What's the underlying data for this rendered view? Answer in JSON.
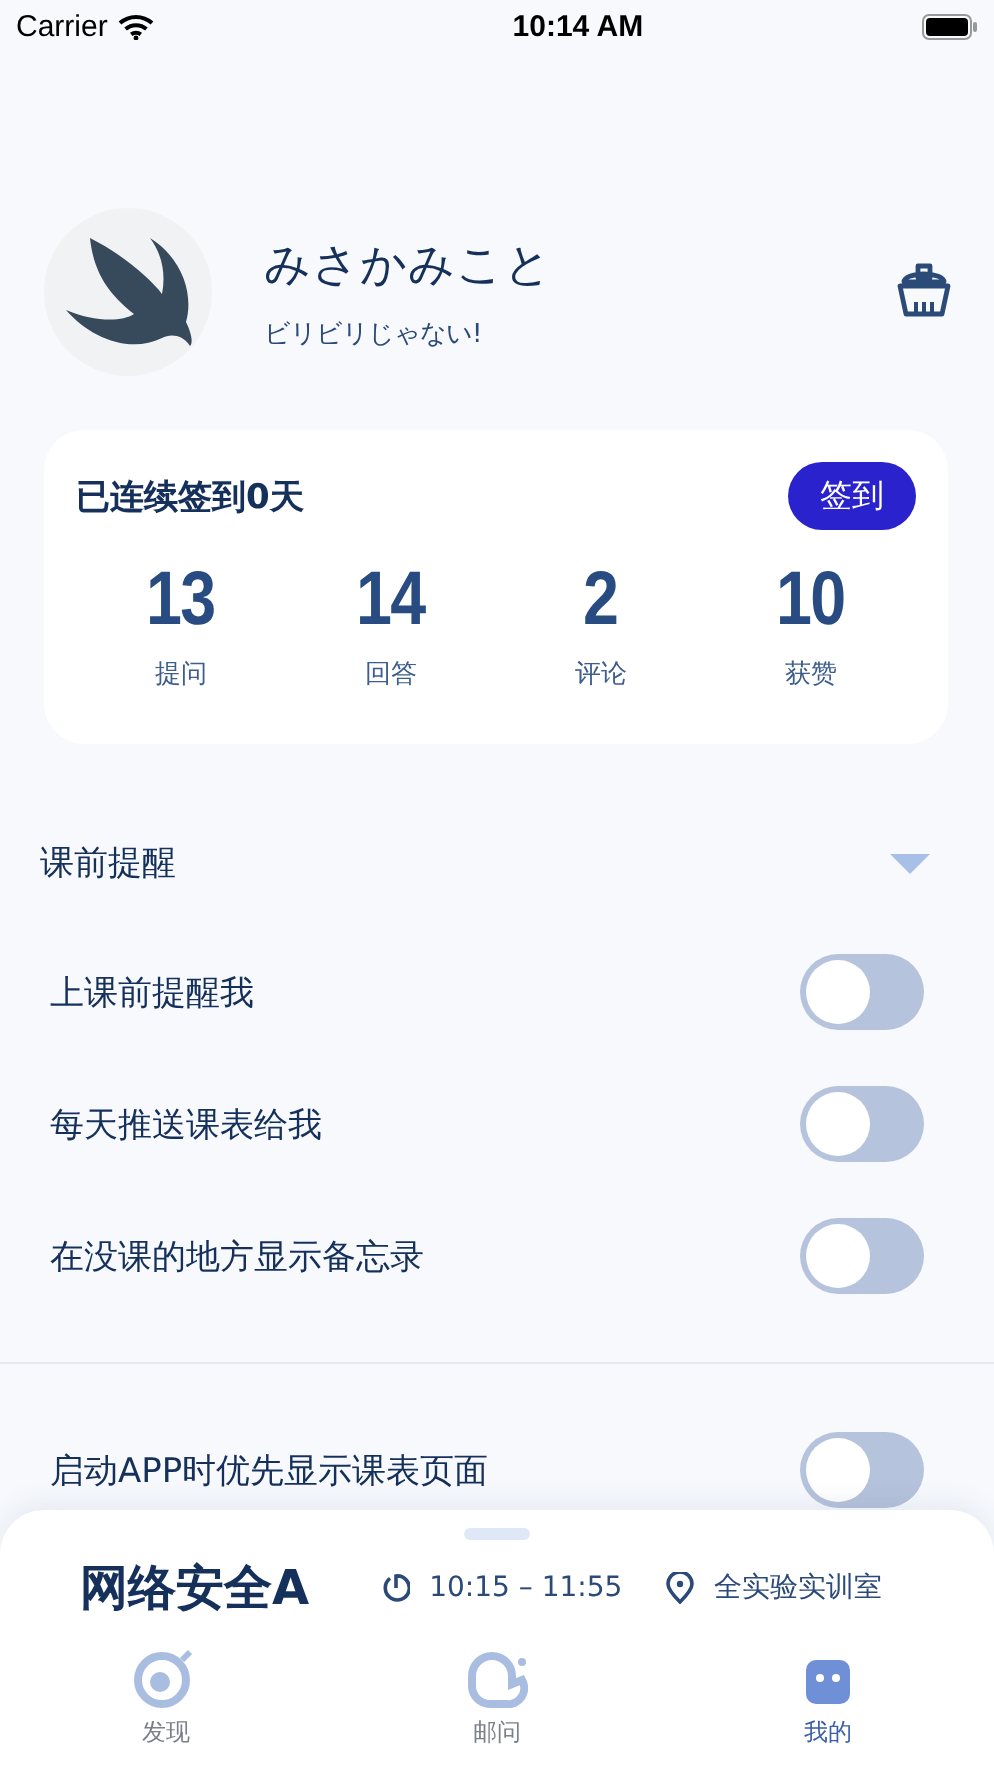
{
  "status_bar": {
    "carrier": "Carrier",
    "time": "10:14 AM"
  },
  "profile": {
    "name": "みさかみこと",
    "motto": "ビリビリじゃない!"
  },
  "checkin": {
    "title": "已连续签到0天",
    "button": "签到",
    "stats": [
      {
        "value": "13",
        "label": "提问"
      },
      {
        "value": "14",
        "label": "回答"
      },
      {
        "value": "2",
        "label": "评论"
      },
      {
        "value": "10",
        "label": "获赞"
      }
    ]
  },
  "section": {
    "title": "课前提醒",
    "expanded": true
  },
  "settings": [
    {
      "label": "上课前提醒我",
      "on": false
    },
    {
      "label": "每天推送课表给我",
      "on": false
    },
    {
      "label": "在没课的地方显示备忘录",
      "on": false
    },
    {
      "label": "启动APP时优先显示课表页面",
      "on": false
    }
  ],
  "course_sheet": {
    "course": "网络安全A",
    "time": "10:15 – 11:55",
    "location": "全实验实训室"
  },
  "tabs": [
    {
      "label": "发现",
      "selected": false
    },
    {
      "label": "邮问",
      "selected": false
    },
    {
      "label": "我的",
      "selected": true
    }
  ]
}
